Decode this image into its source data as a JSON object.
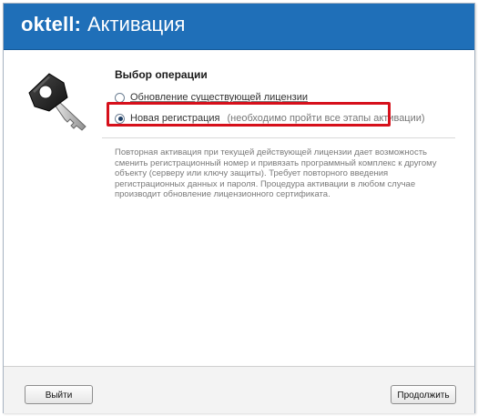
{
  "header": {
    "brand": "oktell:",
    "title": "Активация"
  },
  "operation": {
    "section_title": "Выбор операции",
    "options": [
      {
        "label": "Обновление существующей лицензии",
        "selected": false
      },
      {
        "label": "Новая регистрация",
        "hint": "(необходимо пройти все этапы активации)",
        "selected": true
      }
    ]
  },
  "description": {
    "lines": [
      "Повторная активация при текущей действующей лицензии дает возможность",
      "сменить регистрационный номер и привязать программный комплекс к другому",
      "объекту (серверу или ключу защиты). Требует повторного введения",
      "регистрационных данных и пароля. Процедура активации в любом случае",
      "производит обновление лицензионного сертификата."
    ]
  },
  "footer": {
    "exit_label": "Выйти",
    "next_label": "Продолжить"
  },
  "colors": {
    "header_bg": "#1f6fb8",
    "highlight": "#d6101b"
  },
  "icons": {
    "key": "key-icon"
  }
}
